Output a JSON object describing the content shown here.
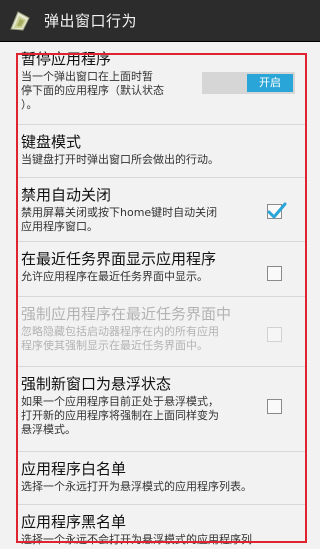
{
  "app_bar": {
    "title": "弹出窗口行为",
    "icon": "app-logo-icon"
  },
  "prefs": {
    "pause": {
      "title": "暂停应用程序",
      "summary_line1": "当一个弹出窗口在上面时暂",
      "summary_line2": "停下面的应用程序（默认状态",
      "summary_line3": "）。",
      "toggle_label": "开启",
      "toggle_on": true
    },
    "keyboard": {
      "title": "键盘模式",
      "summary": "当键盘打开时弹出窗口所会做出的行动。"
    },
    "auto_close": {
      "title": "禁用自动关闭",
      "summary_line1": "禁用屏幕关闭或按下home键时自动关闭",
      "summary_line2": "应用程序窗口。",
      "checked": true
    },
    "show_recents": {
      "title": "在最近任务界面显示应用程序",
      "summary": "允许应用程序在最近任务界面中显示。",
      "checked": false
    },
    "force_recents": {
      "title": "强制应用程序在最近任务界面中",
      "summary_line1": "忽略隐藏包括启动器程序在内的所有应用",
      "summary_line2": "程序使其强制显示在最近任务界面中。",
      "checked": false,
      "enabled": false
    },
    "force_floating": {
      "title": "强制新窗口为悬浮状态",
      "summary_line1": "如果一个应用程序目前正处于悬浮模式，",
      "summary_line2": "打开新的应用程序将强制在上面同样变为",
      "summary_line3": "悬浮模式。",
      "checked": false
    },
    "whitelist": {
      "title": "应用程序白名单",
      "summary": "选择一个永远打开为悬浮模式的应用程序列表。"
    },
    "blacklist": {
      "title": "应用程序黑名单",
      "summary": "选择一个永远不会打开为悬浮模式的应用程序列"
    }
  },
  "colors": {
    "accent": "#2aa5d8",
    "highlight": "#e0242f",
    "app_bar": "#2c2c2c"
  }
}
